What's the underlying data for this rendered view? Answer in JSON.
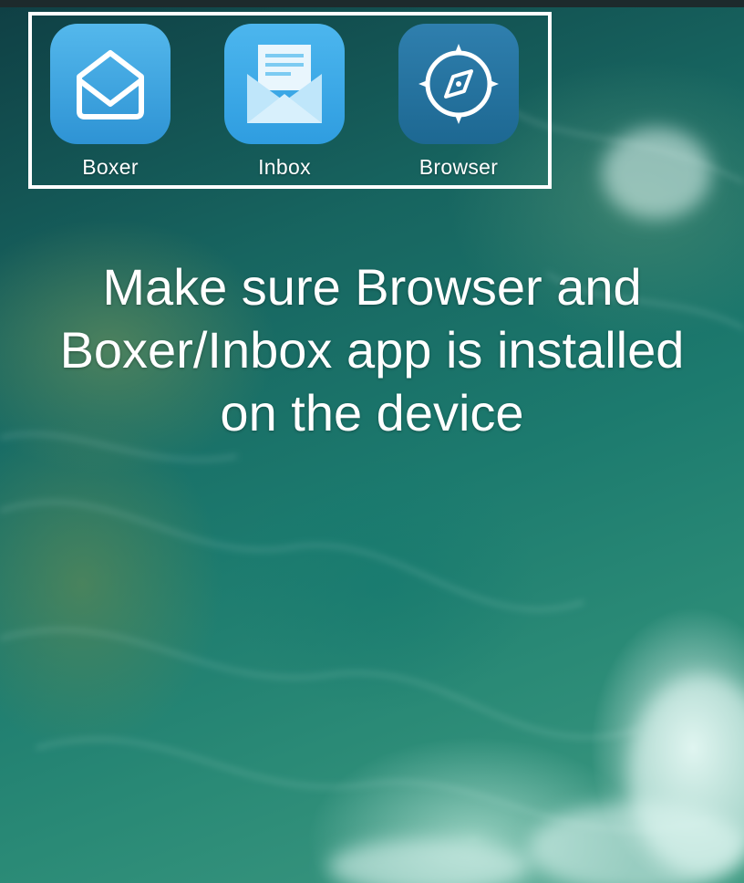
{
  "apps": [
    {
      "name": "Boxer",
      "icon": "boxer-envelope-icon"
    },
    {
      "name": "Inbox",
      "icon": "inbox-mail-icon"
    },
    {
      "name": "Browser",
      "icon": "compass-icon"
    }
  ],
  "message": {
    "line1": "Make sure Browser and",
    "line2": "Boxer/Inbox app is installed",
    "line3": "on the device"
  },
  "colors": {
    "highlight_border": "#ffffff",
    "boxer_icon": "#3fa6e1",
    "inbox_icon": "#3aa9e8",
    "browser_icon": "#24739f"
  }
}
